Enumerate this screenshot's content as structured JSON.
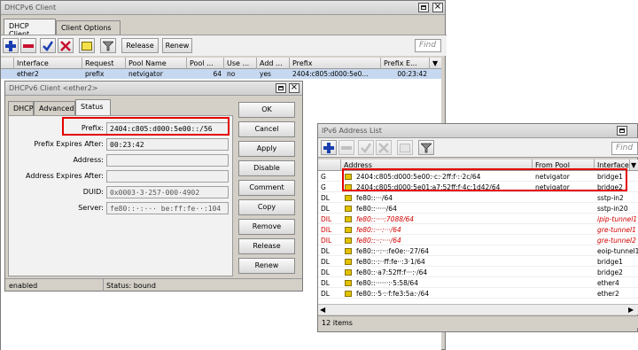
{
  "main_window": {
    "title": "DHCPv6 Client",
    "tabs": [
      "DHCP Client",
      "Client Options"
    ],
    "toolbar": {
      "release": "Release",
      "renew": "Renew",
      "find_placeholder": "Find"
    },
    "columns": [
      "Interface",
      "Request",
      "Pool Name",
      "Pool ...",
      "Use ...",
      "Add ...",
      "Prefix",
      "Prefix E..."
    ],
    "row": {
      "interface": "ether2",
      "request": "prefix",
      "pool_name": "netvigator",
      "pool_len": "64",
      "use": "no",
      "add": "yes",
      "prefix": "2404:c805:d000:5e0...",
      "prefix_expires": "00:23:42"
    }
  },
  "dialog": {
    "title": "DHCPv6 Client <ether2>",
    "tabs": [
      "DHCP",
      "Advanced",
      "Status"
    ],
    "fields": {
      "prefix": {
        "label": "Prefix:",
        "value": "2404:c805:d000:5e00::/56"
      },
      "prefix_expires": {
        "label": "Prefix Expires After:",
        "value": "00:23:42"
      },
      "address": {
        "label": "Address:",
        "value": ""
      },
      "address_expires": {
        "label": "Address Expires After:",
        "value": ""
      },
      "duid": {
        "label": "DUID:",
        "value": "0x0003·3·257·000·4902"
      },
      "server": {
        "label": "Server:",
        "value": "fe80::·:··· be:ff:fe··:104"
      }
    },
    "buttons": [
      "OK",
      "Cancel",
      "Apply",
      "Disable",
      "Comment",
      "Copy",
      "Remove",
      "Release",
      "Renew"
    ],
    "status_left": "enabled",
    "status_right": "Status: bound"
  },
  "ipv6_window": {
    "title": "IPv6 Address List",
    "find_placeholder": "Find",
    "columns": [
      "Address",
      "From Pool",
      "Interface"
    ],
    "rows": [
      {
        "flag": "G",
        "address": "2404:c805:d000:5e00:·c:·2ff:f·:·2c/64",
        "pool": "netvigator",
        "iface": "bridge1",
        "red": false
      },
      {
        "flag": "G",
        "address": "2404:c805:d000:5e01:a7:52ff:f·4c:1d42/64",
        "pool": "netvigator",
        "iface": "bridge2",
        "red": false
      },
      {
        "flag": "DL",
        "address": "fe80::···/64",
        "pool": "",
        "iface": "sstp-in2",
        "red": false
      },
      {
        "flag": "DL",
        "address": "fe80::·····/64",
        "pool": "",
        "iface": "sstp-in20",
        "red": false
      },
      {
        "flag": "DIL",
        "address": "fe80::····:7088/64",
        "pool": "",
        "iface": "ipip-tunnel1",
        "red": true
      },
      {
        "flag": "DIL",
        "address": "fe80::···:···/64",
        "pool": "",
        "iface": "gre-tunnel1",
        "red": true
      },
      {
        "flag": "DIL",
        "address": "fe80::··:····/64",
        "pool": "",
        "iface": "gre-tunnel2",
        "red": true
      },
      {
        "flag": "DL",
        "address": "fe80::··:··:fe0e:··27/64",
        "pool": "",
        "iface": "eoip-tunnel1",
        "red": false
      },
      {
        "flag": "DL",
        "address": "fe80::·:··ff:fe··:3·1/64",
        "pool": "",
        "iface": "bridge1",
        "red": false
      },
      {
        "flag": "DL",
        "address": "fe80::·a7:52ff:f···:·/64",
        "pool": "",
        "iface": "bridge2",
        "red": false
      },
      {
        "flag": "DL",
        "address": "fe80::······:·5:58/64",
        "pool": "",
        "iface": "ether4",
        "red": false
      },
      {
        "flag": "DL",
        "address": "fe80::·5·:·f:fe3:5a:·/64",
        "pool": "",
        "iface": "ether2",
        "red": false
      }
    ],
    "status": "12 items"
  },
  "colors": {
    "highlight_red": "#e30000",
    "selected_row": "#c6d8f0",
    "invalid_text": "#d00000"
  }
}
